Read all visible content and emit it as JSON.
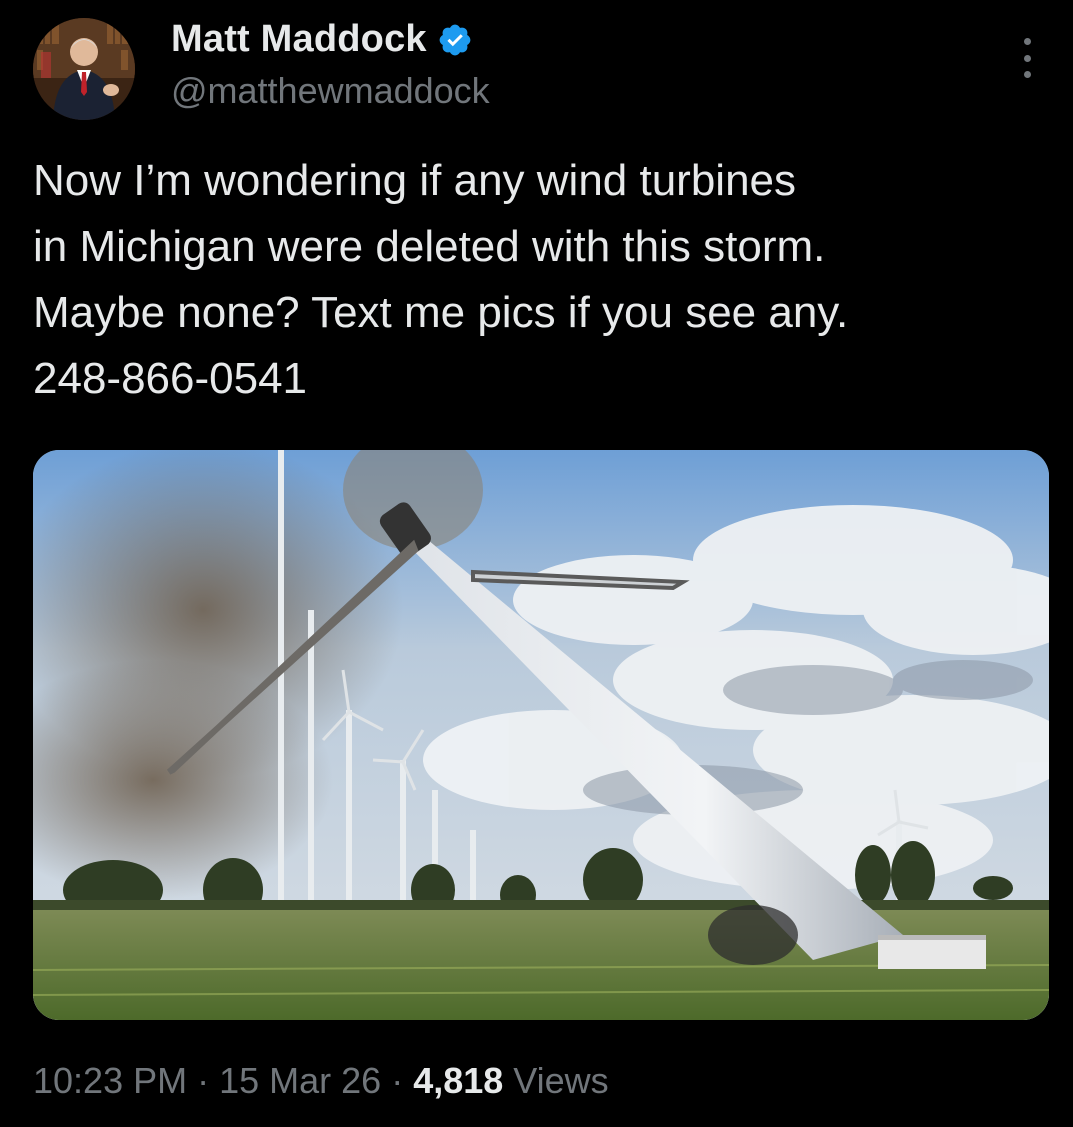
{
  "author": {
    "display_name": "Matt Maddock",
    "handle": "@matthewmaddock",
    "verified": true,
    "avatar_icon": "avatar-photo",
    "verified_color": "#1d9bf0"
  },
  "tweet": {
    "text": "Now I’m wondering if any wind turbines\nin Michigan were deleted with this storm.\nMaybe none? Text me pics if you see any.\n248-866-0541",
    "media_icon": "collapsed-wind-turbine-photo"
  },
  "meta": {
    "time": "10:23 PM",
    "separator": "·",
    "date": "15 Mar 26",
    "views_count": "4,818",
    "views_label": "Views"
  },
  "icons": {
    "more": "more-options-icon",
    "verified": "verified-badge-icon"
  }
}
